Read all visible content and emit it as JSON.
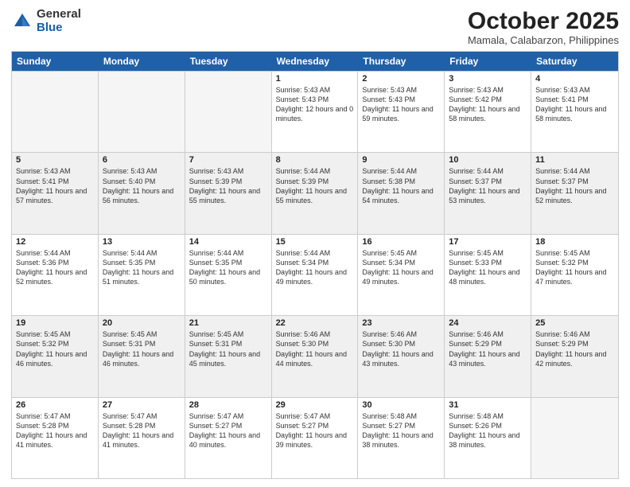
{
  "logo": {
    "general": "General",
    "blue": "Blue"
  },
  "header": {
    "month": "October 2025",
    "location": "Mamala, Calabarzon, Philippines"
  },
  "days": [
    "Sunday",
    "Monday",
    "Tuesday",
    "Wednesday",
    "Thursday",
    "Friday",
    "Saturday"
  ],
  "rows": [
    [
      {
        "day": "",
        "empty": true
      },
      {
        "day": "",
        "empty": true
      },
      {
        "day": "",
        "empty": true
      },
      {
        "day": "1",
        "sunrise": "5:43 AM",
        "sunset": "5:43 PM",
        "daylight": "12 hours and 0 minutes."
      },
      {
        "day": "2",
        "sunrise": "5:43 AM",
        "sunset": "5:43 PM",
        "daylight": "11 hours and 59 minutes."
      },
      {
        "day": "3",
        "sunrise": "5:43 AM",
        "sunset": "5:42 PM",
        "daylight": "11 hours and 58 minutes."
      },
      {
        "day": "4",
        "sunrise": "5:43 AM",
        "sunset": "5:41 PM",
        "daylight": "11 hours and 58 minutes."
      }
    ],
    [
      {
        "day": "5",
        "sunrise": "5:43 AM",
        "sunset": "5:41 PM",
        "daylight": "11 hours and 57 minutes."
      },
      {
        "day": "6",
        "sunrise": "5:43 AM",
        "sunset": "5:40 PM",
        "daylight": "11 hours and 56 minutes."
      },
      {
        "day": "7",
        "sunrise": "5:43 AM",
        "sunset": "5:39 PM",
        "daylight": "11 hours and 55 minutes."
      },
      {
        "day": "8",
        "sunrise": "5:44 AM",
        "sunset": "5:39 PM",
        "daylight": "11 hours and 55 minutes."
      },
      {
        "day": "9",
        "sunrise": "5:44 AM",
        "sunset": "5:38 PM",
        "daylight": "11 hours and 54 minutes."
      },
      {
        "day": "10",
        "sunrise": "5:44 AM",
        "sunset": "5:37 PM",
        "daylight": "11 hours and 53 minutes."
      },
      {
        "day": "11",
        "sunrise": "5:44 AM",
        "sunset": "5:37 PM",
        "daylight": "11 hours and 52 minutes."
      }
    ],
    [
      {
        "day": "12",
        "sunrise": "5:44 AM",
        "sunset": "5:36 PM",
        "daylight": "11 hours and 52 minutes."
      },
      {
        "day": "13",
        "sunrise": "5:44 AM",
        "sunset": "5:35 PM",
        "daylight": "11 hours and 51 minutes."
      },
      {
        "day": "14",
        "sunrise": "5:44 AM",
        "sunset": "5:35 PM",
        "daylight": "11 hours and 50 minutes."
      },
      {
        "day": "15",
        "sunrise": "5:44 AM",
        "sunset": "5:34 PM",
        "daylight": "11 hours and 49 minutes."
      },
      {
        "day": "16",
        "sunrise": "5:45 AM",
        "sunset": "5:34 PM",
        "daylight": "11 hours and 49 minutes."
      },
      {
        "day": "17",
        "sunrise": "5:45 AM",
        "sunset": "5:33 PM",
        "daylight": "11 hours and 48 minutes."
      },
      {
        "day": "18",
        "sunrise": "5:45 AM",
        "sunset": "5:32 PM",
        "daylight": "11 hours and 47 minutes."
      }
    ],
    [
      {
        "day": "19",
        "sunrise": "5:45 AM",
        "sunset": "5:32 PM",
        "daylight": "11 hours and 46 minutes."
      },
      {
        "day": "20",
        "sunrise": "5:45 AM",
        "sunset": "5:31 PM",
        "daylight": "11 hours and 46 minutes."
      },
      {
        "day": "21",
        "sunrise": "5:45 AM",
        "sunset": "5:31 PM",
        "daylight": "11 hours and 45 minutes."
      },
      {
        "day": "22",
        "sunrise": "5:46 AM",
        "sunset": "5:30 PM",
        "daylight": "11 hours and 44 minutes."
      },
      {
        "day": "23",
        "sunrise": "5:46 AM",
        "sunset": "5:30 PM",
        "daylight": "11 hours and 43 minutes."
      },
      {
        "day": "24",
        "sunrise": "5:46 AM",
        "sunset": "5:29 PM",
        "daylight": "11 hours and 43 minutes."
      },
      {
        "day": "25",
        "sunrise": "5:46 AM",
        "sunset": "5:29 PM",
        "daylight": "11 hours and 42 minutes."
      }
    ],
    [
      {
        "day": "26",
        "sunrise": "5:47 AM",
        "sunset": "5:28 PM",
        "daylight": "11 hours and 41 minutes."
      },
      {
        "day": "27",
        "sunrise": "5:47 AM",
        "sunset": "5:28 PM",
        "daylight": "11 hours and 41 minutes."
      },
      {
        "day": "28",
        "sunrise": "5:47 AM",
        "sunset": "5:27 PM",
        "daylight": "11 hours and 40 minutes."
      },
      {
        "day": "29",
        "sunrise": "5:47 AM",
        "sunset": "5:27 PM",
        "daylight": "11 hours and 39 minutes."
      },
      {
        "day": "30",
        "sunrise": "5:48 AM",
        "sunset": "5:27 PM",
        "daylight": "11 hours and 38 minutes."
      },
      {
        "day": "31",
        "sunrise": "5:48 AM",
        "sunset": "5:26 PM",
        "daylight": "11 hours and 38 minutes."
      },
      {
        "day": "",
        "empty": true
      }
    ]
  ]
}
